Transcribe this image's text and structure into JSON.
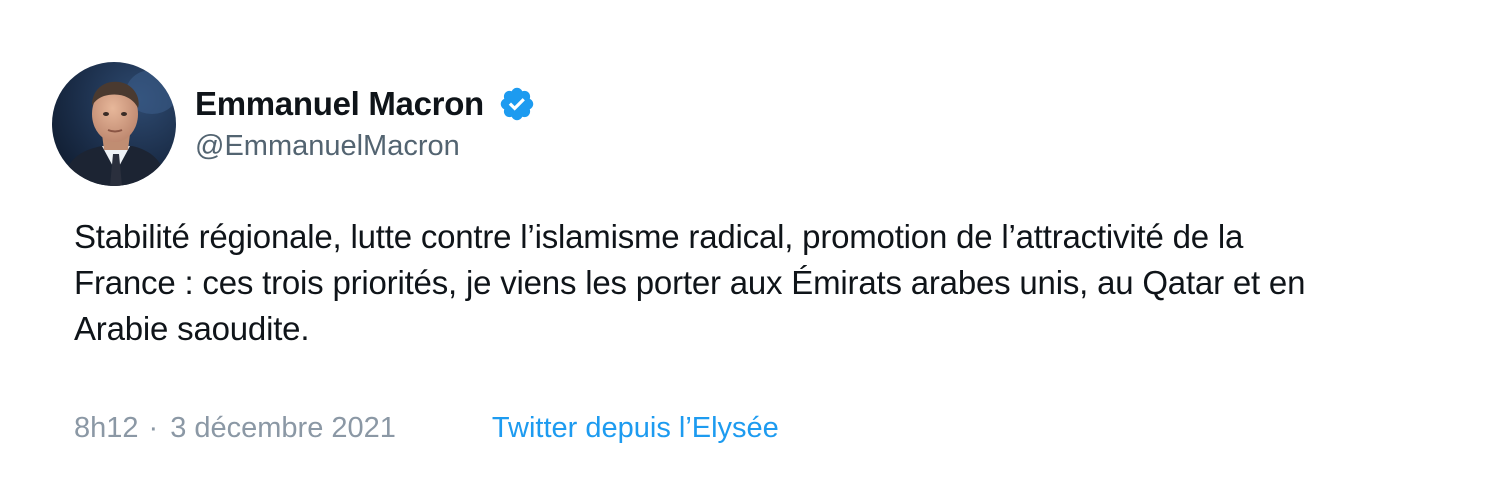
{
  "author": {
    "name": "Emmanuel Macron",
    "handle": "@EmmanuelMacron",
    "verified_icon": "verified-badge-icon",
    "avatar_icon": "profile-photo"
  },
  "tweet": {
    "text": "Stabilité régionale, lutte contre l’islamisme radical, promotion de l’attractivité de la\nFrance : ces trois priorités, je viens les porter aux Émirats arabes unis, au Qatar et en\nArabie saoudite."
  },
  "meta": {
    "time": "8h12",
    "separator": "·",
    "date": "3 décembre 2021",
    "source": "Twitter depuis l’Elysée"
  },
  "colors": {
    "link": "#1d9bf0",
    "muted": "#8b98a5",
    "text": "#0f1419",
    "background": "#ffffff"
  }
}
